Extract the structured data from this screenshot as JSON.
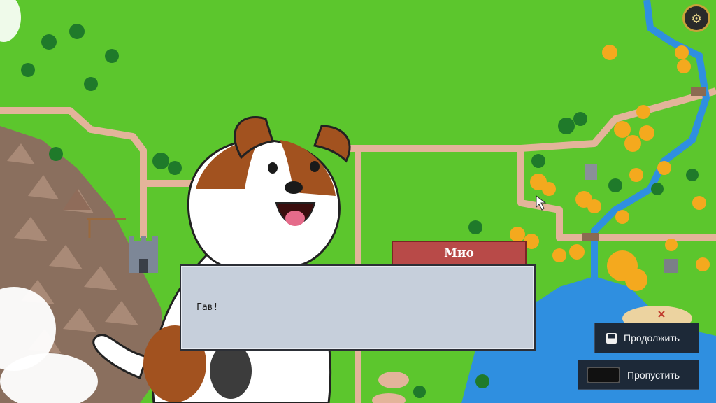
{
  "dialog": {
    "speaker": "Мио",
    "text": "Гав!"
  },
  "buttons": {
    "continue_label": "Продолжить",
    "skip_label": "Пропустить"
  },
  "icons": {
    "settings": "gear-icon",
    "continue_key": "key-icon",
    "skip_key": "spacebar-icon",
    "cursor": "mouse-cursor-icon"
  },
  "colors": {
    "grass": "#5cc62d",
    "path": "#e3b49a",
    "water": "#2f8fe0",
    "autumn_trees": "#f4a91e",
    "name_plate": "#b84a48",
    "dialog_bg": "#c6cfdb",
    "button_bg": "#1d2938"
  }
}
